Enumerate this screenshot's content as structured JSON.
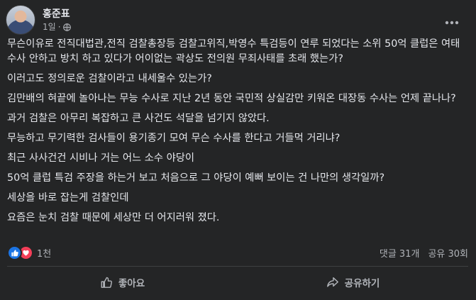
{
  "post": {
    "author": "홍준표",
    "time": "1일",
    "privacy_icon": "globe-icon",
    "paragraphs": [
      "무슨이유로 전직대법관,전직 검찰총장등 검찰고위직,박영수 특검등이 연루 되었다는 소위 50억 클럽은 여태 수사 안하고 방치 하고 있다가 어이없는 곽상도 전의원 무죄사태를 초래 했는가?",
      "이러고도 정의로운 검찰이라고 내세울수 있는가?",
      "김만배의 혀끝에 놀아나는 무능 수사로 지난 2년 동안 국민적 상실감만 키워온 대장동 수사는 언제 끝나나?",
      "과거 검찰은 아무리 복잡하고 큰 사건도 석달을 넘기지 않았다.",
      "무능하고 무기력한 검사들이 용기종기 모여 무슨 수사를 한다고 거들먹 거리냐?",
      "최근 사사건건 시비나 거는 어느 소수 야당이",
      "50억 클럽 특검 주장을 하는거 보고 처음으로 그 야당이 예뻐 보이는 건 나만의 생각일까?",
      "세상을 바로 잡는게 검찰인데",
      "요즘은 눈치 검찰 때문에 세상만 더 어지러워 졌다."
    ]
  },
  "stats": {
    "reaction_count": "1천",
    "comments": "댓글 31개",
    "shares": "공유 30회"
  },
  "actions": {
    "like_label": "좋아요",
    "share_label": "공유하기"
  },
  "colors": {
    "background": "#242526",
    "text": "#e4e6eb",
    "secondary_text": "#b0b3b8",
    "like_blue": "#1b74e4",
    "love_red": "#f33e58"
  }
}
